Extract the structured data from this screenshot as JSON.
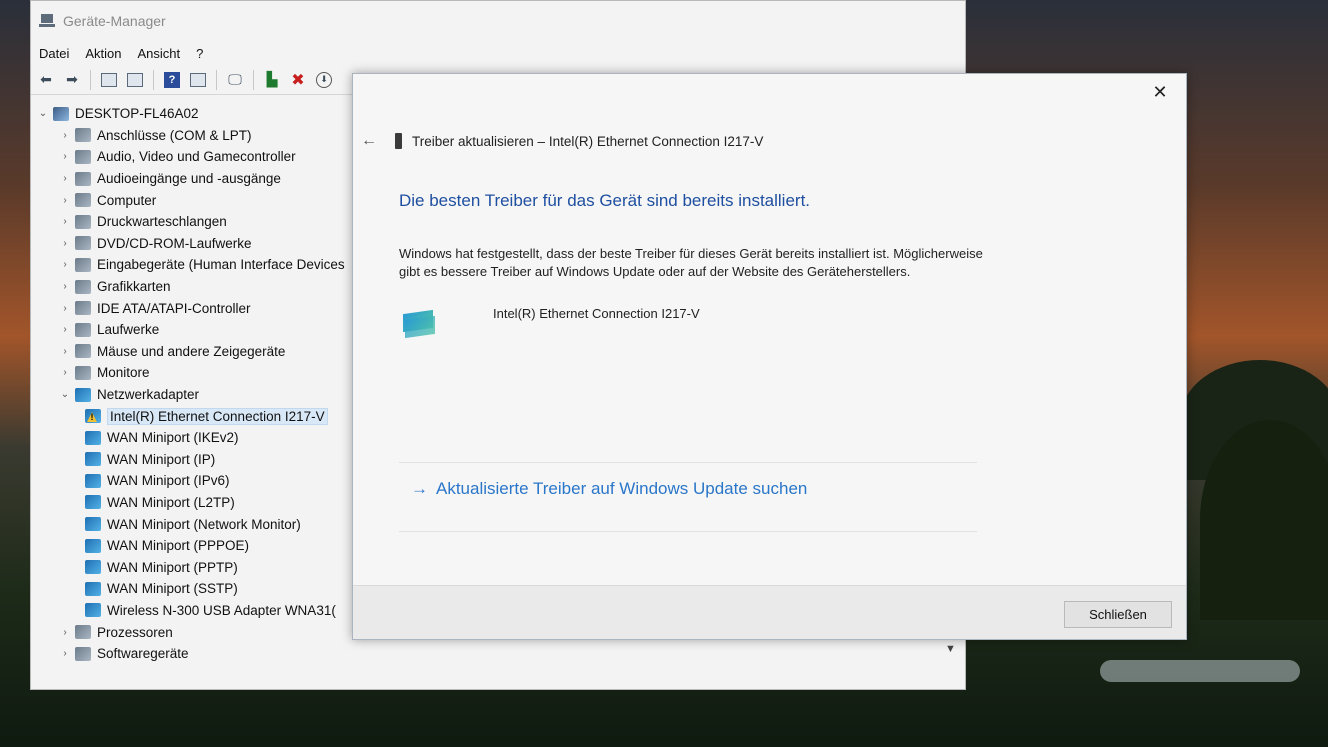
{
  "colors": {
    "heading_blue": "#1f4fa0",
    "link_blue": "#2a76c9",
    "selection": "#d9e8f7"
  },
  "device_manager": {
    "title": "Geräte-Manager",
    "menu": [
      "Datei",
      "Aktion",
      "Ansicht",
      "?"
    ],
    "toolbar_icons": [
      "back-icon",
      "forward-icon",
      "properties-icon",
      "list-icon",
      "help-icon",
      "view-icon",
      "monitor-icon",
      "update-driver-icon",
      "uninstall-icon",
      "download-icon"
    ],
    "tree": [
      {
        "label": "DESKTOP-FL46A02",
        "level": 0,
        "expanded": true,
        "icon": "computer-icon"
      },
      {
        "label": "Anschlüsse (COM & LPT)",
        "level": 1,
        "expanded": false,
        "icon": "port-icon"
      },
      {
        "label": "Audio, Video und Gamecontroller",
        "level": 1,
        "expanded": false,
        "icon": "audio-icon"
      },
      {
        "label": "Audioeingänge und -ausgänge",
        "level": 1,
        "expanded": false,
        "icon": "speaker-icon"
      },
      {
        "label": "Computer",
        "level": 1,
        "expanded": false,
        "icon": "computer-icon"
      },
      {
        "label": "Druckwarteschlangen",
        "level": 1,
        "expanded": false,
        "icon": "printer-icon"
      },
      {
        "label": "DVD/CD-ROM-Laufwerke",
        "level": 1,
        "expanded": false,
        "icon": "dvd-icon"
      },
      {
        "label": "Eingabegeräte (Human Interface Devices",
        "level": 1,
        "expanded": false,
        "icon": "hid-icon"
      },
      {
        "label": "Grafikkarten",
        "level": 1,
        "expanded": false,
        "icon": "display-adapter-icon"
      },
      {
        "label": "IDE ATA/ATAPI-Controller",
        "level": 1,
        "expanded": false,
        "icon": "ide-icon"
      },
      {
        "label": "Laufwerke",
        "level": 1,
        "expanded": false,
        "icon": "drive-icon"
      },
      {
        "label": "Mäuse und andere Zeigegeräte",
        "level": 1,
        "expanded": false,
        "icon": "mouse-icon"
      },
      {
        "label": "Monitore",
        "level": 1,
        "expanded": false,
        "icon": "monitor-icon"
      },
      {
        "label": "Netzwerkadapter",
        "level": 1,
        "expanded": true,
        "icon": "network-adapter-icon"
      },
      {
        "label": "Intel(R) Ethernet Connection I217-V",
        "level": 2,
        "selected": true,
        "warning": true,
        "icon": "network-adapter-icon"
      },
      {
        "label": "WAN Miniport (IKEv2)",
        "level": 2,
        "icon": "network-adapter-icon"
      },
      {
        "label": "WAN Miniport (IP)",
        "level": 2,
        "icon": "network-adapter-icon"
      },
      {
        "label": "WAN Miniport (IPv6)",
        "level": 2,
        "icon": "network-adapter-icon"
      },
      {
        "label": "WAN Miniport (L2TP)",
        "level": 2,
        "icon": "network-adapter-icon"
      },
      {
        "label": "WAN Miniport (Network Monitor)",
        "level": 2,
        "icon": "network-adapter-icon"
      },
      {
        "label": "WAN Miniport (PPPOE)",
        "level": 2,
        "icon": "network-adapter-icon"
      },
      {
        "label": "WAN Miniport (PPTP)",
        "level": 2,
        "icon": "network-adapter-icon"
      },
      {
        "label": "WAN Miniport (SSTP)",
        "level": 2,
        "icon": "network-adapter-icon"
      },
      {
        "label": "Wireless N-300 USB Adapter WNA31(",
        "level": 2,
        "icon": "network-adapter-icon"
      },
      {
        "label": "Prozessoren",
        "level": 1,
        "expanded": false,
        "icon": "cpu-icon"
      },
      {
        "label": "Softwaregeräte",
        "level": 1,
        "expanded": false,
        "icon": "software-device-icon"
      }
    ]
  },
  "dialog": {
    "header": "Treiber aktualisieren – Intel(R) Ethernet Connection I217-V",
    "heading": "Die besten Treiber für das Gerät sind bereits installiert.",
    "description_line1": "Windows hat festgestellt, dass der beste Treiber für dieses Gerät bereits installiert ist. Möglicherweise",
    "description_line2": "gibt es bessere Treiber auf Windows Update oder auf der Website des Geräteherstellers.",
    "device_name": "Intel(R) Ethernet Connection I217-V",
    "link": "Aktualisierte Treiber auf Windows Update suchen",
    "close_button": "Schließen"
  }
}
